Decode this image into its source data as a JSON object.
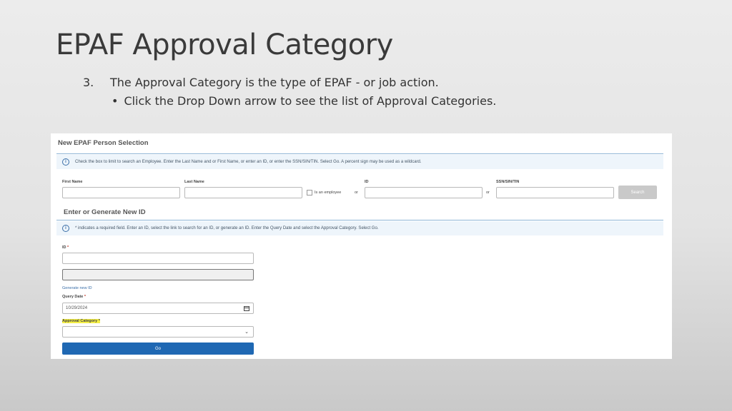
{
  "slide": {
    "title": "EPAF Approval Category",
    "step_number": "3.",
    "step_text": "The Approval Category is the type of EPAF  - or job action.",
    "sub_bullet": "•",
    "sub_text": "Click the Drop Down arrow to see the list of Approval Categories."
  },
  "form": {
    "panel_title": "New EPAF Person Selection",
    "info_text": "Check the box to limit to search an Employee. Enter the Last Name and or First Name, or enter an ID, or enter the SSN/SIN/TIN. Select Go. A percent sign may be used as a wildcard.",
    "labels": {
      "first_name": "First Name",
      "last_name": "Last Name",
      "is_employee": "Is an employee",
      "or": "or",
      "id": "ID",
      "ssn": "SSN/SIN/TIN"
    },
    "search_button": "Search",
    "section_title": "Enter or Generate New ID",
    "required_info": "* indicates a required field. Enter an ID, select the link to search for an ID, or generate an ID. Enter the Query Date and select the Approval Category. Select Go.",
    "id_label": "ID",
    "required_mark": "*",
    "generate_link": "Generate new ID",
    "query_date_label": "Query Date",
    "query_date_value": "10/29/2024",
    "approval_category_label": "Approval Category *",
    "go_button": "Go",
    "icons": {
      "info": "info-icon",
      "calendar": "calendar-icon",
      "dropdown": "chevron-down-icon"
    },
    "colors": {
      "go_button": "#1f68b3",
      "highlight": "#f4ef45",
      "rule": "#8fb5d6"
    }
  }
}
